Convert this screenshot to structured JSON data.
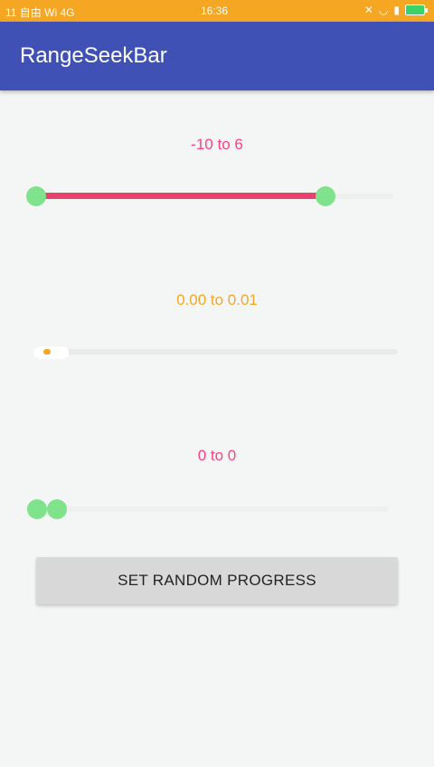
{
  "status_bar": {
    "left_text": "11 自由 Wi 4G",
    "time": "16:36",
    "colors": {
      "background": "#f5a623"
    }
  },
  "app_bar": {
    "title": "RangeSeekBar",
    "color": "#3f51b5"
  },
  "seekbars": [
    {
      "label": "-10 to 6",
      "label_color": "#ff4081",
      "min_value": -10,
      "max_value": 6,
      "range_fraction": [
        0.0,
        0.81
      ],
      "active_color": "#e8436e"
    },
    {
      "label": "0.00 to 0.01",
      "label_color": "#f5a623",
      "min_value": 0.0,
      "max_value": 0.01,
      "range_fraction": [
        0.0,
        0.02
      ],
      "active_color": "#f5a623"
    },
    {
      "label": "0 to 0",
      "label_color": "#ff4081",
      "min_value": 0,
      "max_value": 0,
      "range_fraction": [
        0.0,
        0.05
      ],
      "active_color": "#7ee38a"
    }
  ],
  "button": {
    "label": "SET RANDOM PROGRESS"
  }
}
